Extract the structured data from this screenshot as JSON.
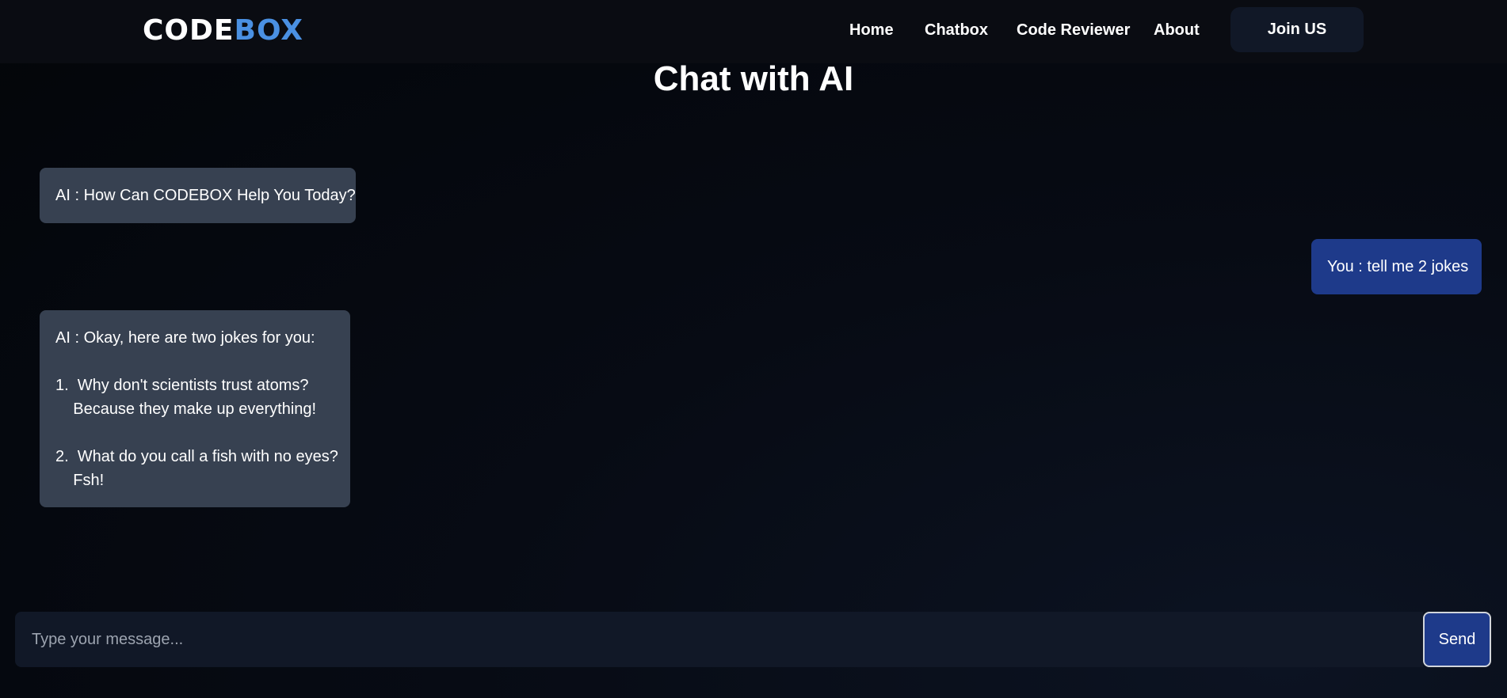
{
  "header": {
    "logo_part1": "CODE",
    "logo_part2": "BOX",
    "nav": [
      "Home",
      "Chatbox",
      "Code Reviewer",
      "About"
    ],
    "join_label": "Join US"
  },
  "page": {
    "title": "Chat with AI"
  },
  "messages": [
    {
      "role": "ai",
      "lines": [
        "AI : How Can CODEBOX Help You Today?"
      ]
    },
    {
      "role": "user",
      "lines": [
        "You : tell me 2 jokes"
      ]
    },
    {
      "role": "ai",
      "lines": [
        "AI : Okay, here are two jokes for you:",
        "",
        "1.  Why don't scientists trust atoms?",
        "    Because they make up everything!",
        "",
        "2.  What do you call a fish with no eyes?",
        "    Fsh!"
      ]
    }
  ],
  "composer": {
    "placeholder": "Type your message...",
    "value": "",
    "send_label": "Send"
  },
  "colors": {
    "logo_accent": "#4a90e2",
    "ai_bubble": "#374151",
    "user_bubble": "#1e3a8a",
    "send_button": "#1e3a8a"
  }
}
